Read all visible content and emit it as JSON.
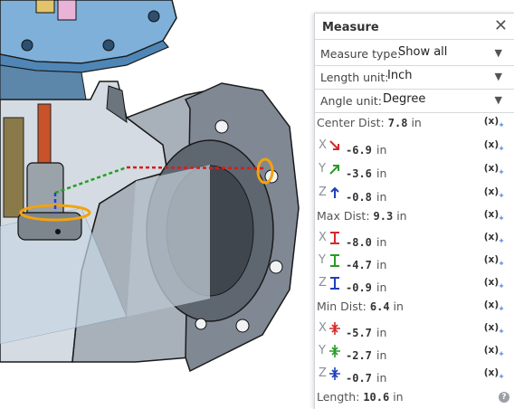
{
  "panel": {
    "title": "Measure",
    "close_icon": "close-icon",
    "selects": [
      {
        "label": "Measure type:",
        "value": "Show all"
      },
      {
        "label": "Length unit:",
        "value": "Inch"
      },
      {
        "label": "Angle unit:",
        "value": "Degree"
      }
    ],
    "center": {
      "label": "Center Dist:",
      "value": "7.8",
      "unit": "in",
      "axes": [
        {
          "axis": "X",
          "value": "-6.9",
          "unit": "in",
          "color": "#d32a2a"
        },
        {
          "axis": "Y",
          "value": "-3.6",
          "unit": "in",
          "color": "#2a9a2a"
        },
        {
          "axis": "Z",
          "value": "-0.8",
          "unit": "in",
          "color": "#1f3fb8"
        }
      ]
    },
    "max": {
      "label": "Max Dist:",
      "value": "9.3",
      "unit": "in",
      "axes": [
        {
          "axis": "X",
          "value": "-8.0",
          "unit": "in",
          "color": "#d32a2a"
        },
        {
          "axis": "Y",
          "value": "-4.7",
          "unit": "in",
          "color": "#2a9a2a"
        },
        {
          "axis": "Z",
          "value": "-0.9",
          "unit": "in",
          "color": "#1f3fb8"
        }
      ]
    },
    "min": {
      "label": "Min Dist:",
      "value": "6.4",
      "unit": "in",
      "axes": [
        {
          "axis": "X",
          "value": "-5.7",
          "unit": "in",
          "color": "#d32a2a"
        },
        {
          "axis": "Y",
          "value": "-2.7",
          "unit": "in",
          "color": "#2a9a2a"
        },
        {
          "axis": "Z",
          "value": "-0.7",
          "unit": "in",
          "color": "#1f3fb8"
        }
      ]
    },
    "length": {
      "label": "Length:",
      "value": "10.6",
      "unit": "in"
    },
    "copy_label": "(x)",
    "help_label": "?"
  }
}
